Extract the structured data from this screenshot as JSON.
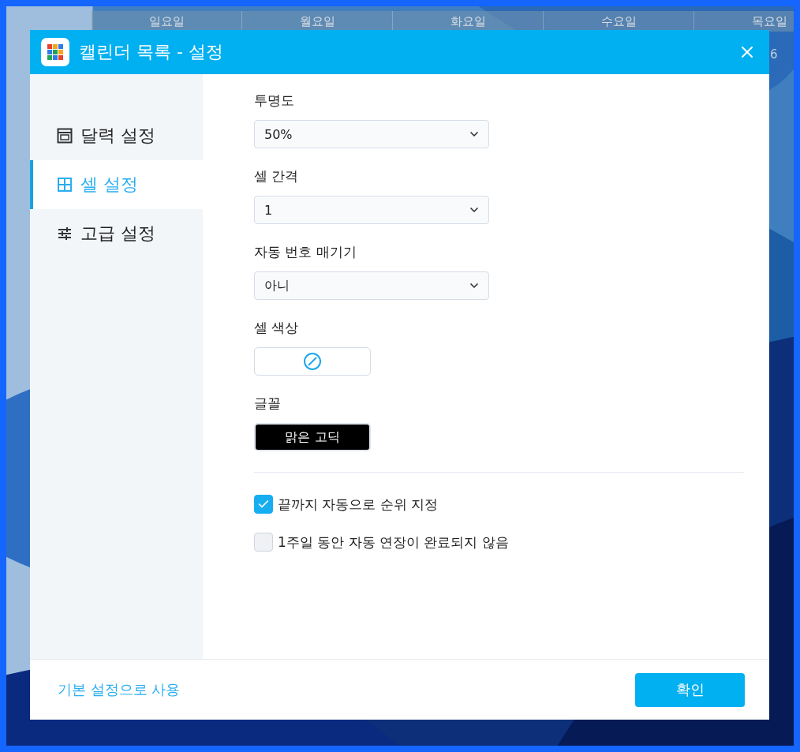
{
  "window": {
    "title": "캘린더 목록 - 설정"
  },
  "background_calendar": {
    "weekdays": [
      "일요일",
      "월요일",
      "화요일",
      "수요일",
      "목요일"
    ],
    "date_number": "6"
  },
  "sidebar": {
    "items": [
      {
        "label": "달력 설정",
        "kind": "calendar",
        "selected": false
      },
      {
        "label": "셀 설정",
        "kind": "grid",
        "selected": true
      },
      {
        "label": "고급 설정",
        "kind": "sliders",
        "selected": false
      }
    ]
  },
  "fields": [
    {
      "kind": "select",
      "label": "투명도",
      "value": "50%"
    },
    {
      "kind": "select",
      "label": "셀 간격",
      "value": "1"
    },
    {
      "kind": "select",
      "label": "자동 번호 매기기",
      "value": "아니"
    },
    {
      "kind": "color",
      "label": "셀 색상"
    },
    {
      "kind": "font",
      "label": "글꼴",
      "value": "맑은 고딕"
    }
  ],
  "checkboxes": [
    {
      "label": "끝까지 자동으로 순위 지정",
      "checked": true
    },
    {
      "label": "1주일 동안 자동 연장이 완료되지 않음",
      "checked": false
    }
  ],
  "footer": {
    "link": "기본 설정으로 사용",
    "button": "확인"
  }
}
